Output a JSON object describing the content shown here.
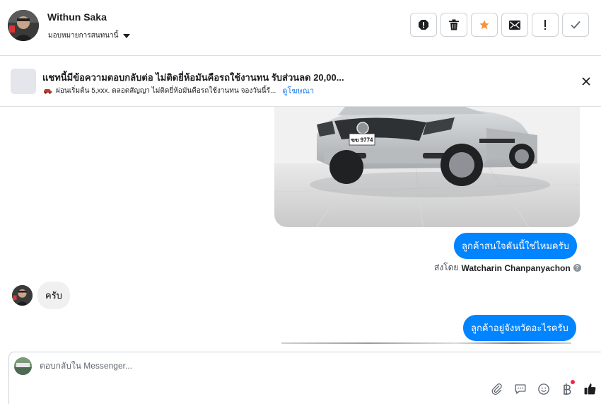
{
  "header": {
    "contact_name": "Withun Saka",
    "assign_label": "มอบหมายการสนทนานี้",
    "actions": [
      {
        "name": "spam-icon"
      },
      {
        "name": "trash-icon"
      },
      {
        "name": "star-icon"
      },
      {
        "name": "mail-icon"
      },
      {
        "name": "follow-up-icon"
      },
      {
        "name": "check-icon"
      }
    ]
  },
  "ad_banner": {
    "title": "แชทนี้มีข้อความตอบกลับต่อ ไม่ติดยี่ห้อมันคือรถใช้งานทน รับส่วนลด 20,00...",
    "subtitle": "ผ่อนเริ่มต้น 5,xxx. ตลอดสัญญา ไม่ติดยี่ห้อมันคือรถใช้งานทน จองวันนี้รั...",
    "link_label": "ดูโฆษณา"
  },
  "messages": {
    "outgoing_1": "ลูกค้าสนใจคันนี้ใช่ไหมครับ",
    "sent_by_prefix": "ส่งโดย",
    "sent_by_name": "Watcharin Chanpanyachon",
    "incoming_1": "ครับ",
    "outgoing_2": "ลูกค้าอยู่จังหวัดอะไรครับ",
    "car_plate": "ขข 9774"
  },
  "composer": {
    "placeholder": "ตอบกลับใน Messenger..."
  },
  "colors": {
    "accent": "#0084ff",
    "link": "#1877f2",
    "star": "#f7923a",
    "incoming_bubble": "#f0f0f0"
  }
}
